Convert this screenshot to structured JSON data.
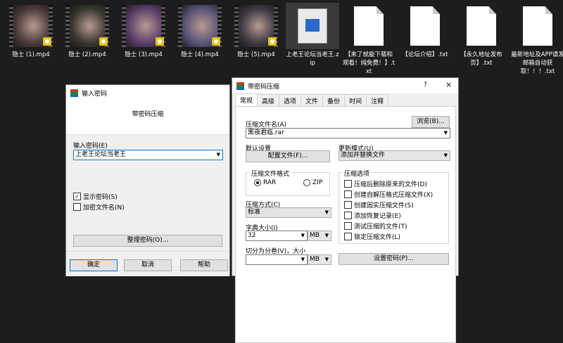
{
  "desktop": {
    "files": [
      {
        "name": "隐士 (1).mp4",
        "kind": "video",
        "tint": "#4a3a3a"
      },
      {
        "name": "隐士 (2).mp4",
        "kind": "video",
        "tint": "#3a3630"
      },
      {
        "name": "隐士 (3).mp4",
        "kind": "video",
        "tint": "#5a3f6a"
      },
      {
        "name": "隐士 (4).mp4",
        "kind": "video",
        "tint": "#5a5478"
      },
      {
        "name": "隐士 (5).mp4",
        "kind": "video",
        "tint": "#3d3842"
      },
      {
        "name": "上老王论坛当老王.zip",
        "kind": "zip"
      },
      {
        "name": "【来了就能下载和观看！纯免费！】.txt",
        "kind": "txt"
      },
      {
        "name": "【论坛介绍】.txt",
        "kind": "txt"
      },
      {
        "name": "【永久地址发布页】.txt",
        "kind": "txt"
      },
      {
        "name": "最新地址及APP请发邮箱自动获取！！！.txt",
        "kind": "txt"
      }
    ]
  },
  "password_dialog": {
    "title": "输入密码",
    "subtitle": "带密码压缩",
    "password_label": "输入密码(E)",
    "password_value": "上老王论坛当老王",
    "show_password": "显示密码(S)",
    "encrypt_names": "加密文件名(N)",
    "organize": "整理密码(O)...",
    "ok": "确定",
    "cancel": "取消",
    "help": "帮助"
  },
  "archive_dialog": {
    "title": "带密码压缩",
    "help_mark": "?",
    "close_mark": "×",
    "tabs": [
      "常规",
      "高级",
      "选项",
      "文件",
      "备份",
      "时间",
      "注释"
    ],
    "archive_name_label": "压缩文件名(A)",
    "browse": "浏览(B)...",
    "archive_name": "黑夜君临.rar",
    "default_settings": "默认设置",
    "profiles": "配置文件(F)...",
    "update_mode_label": "更新模式(U)",
    "update_mode": "添加并替换文件",
    "format_label": "压缩文件格式",
    "format_rar": "RAR",
    "format_zip": "ZIP",
    "method_label": "压缩方式(C)",
    "method": "标准",
    "dict_label": "字典大小(I)",
    "dict_value": "32",
    "dict_unit": "MB",
    "split_label": "切分为分卷(V)，大小",
    "split_unit": "MB",
    "options_label": "压缩选项",
    "options": [
      "压缩后删除原来的文件(D)",
      "创建自解压格式压缩文件(X)",
      "创建固实压缩文件(S)",
      "添加恢复记录(E)",
      "测试压缩的文件(T)",
      "锁定压缩文件(L)"
    ],
    "set_password": "设置密码(P)..."
  },
  "colors": {
    "desktop_bg": "#1d1d1d",
    "accent": "#0078d7",
    "dialog_bg": "#f0f0f0"
  }
}
